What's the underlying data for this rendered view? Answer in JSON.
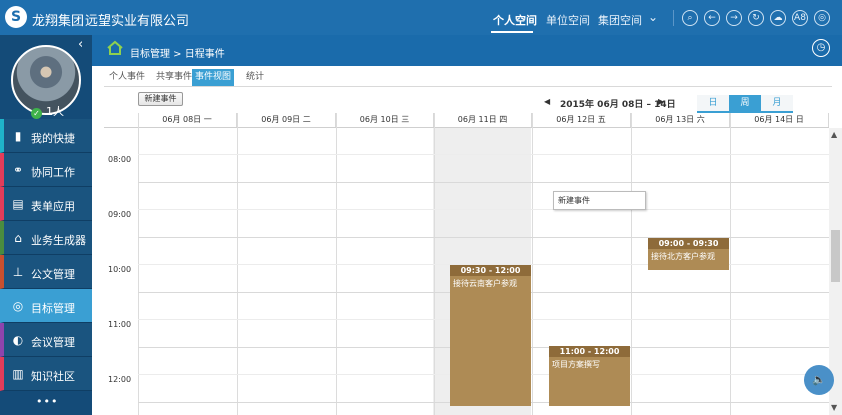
{
  "topbar": {
    "brand": "龙翔集团",
    "company": "远望实业有限公司",
    "nav": [
      {
        "label": "个人空间"
      },
      {
        "label": "单位空间"
      },
      {
        "label": "集团空间"
      }
    ],
    "more_icon": "chevron-down-icon",
    "tools": [
      "search-icon",
      "back-icon",
      "forward-icon",
      "refresh-icon",
      "cloud-icon",
      "font-size-icon",
      "settings-icon"
    ],
    "font_size_label": "A8"
  },
  "sidebar": {
    "user_count": "1人",
    "menu": [
      {
        "label": "我的快捷",
        "icon": "bookmark-icon",
        "accent": "#1fb3c9"
      },
      {
        "label": "协同工作",
        "icon": "collaboration-icon",
        "accent": "#e23c5a"
      },
      {
        "label": "表单应用",
        "icon": "form-icon",
        "accent": "#e23c5a"
      },
      {
        "label": "业务生成器",
        "icon": "house-icon",
        "accent": "#4a8c3f"
      },
      {
        "label": "公文管理",
        "icon": "stamp-icon",
        "accent": "#c8502f"
      },
      {
        "label": "目标管理",
        "icon": "target-icon",
        "accent": "#3a9fd3",
        "active": true
      },
      {
        "label": "会议管理",
        "icon": "meeting-icon",
        "accent": "#8e44ad"
      },
      {
        "label": "知识社区",
        "icon": "book-icon",
        "accent": "#e23c5a"
      }
    ],
    "more": "•••"
  },
  "breadcrumb": "目标管理 > 日程事件",
  "subtabs": [
    {
      "label": "个人事件"
    },
    {
      "label": "共享事件"
    },
    {
      "label": "事件视图",
      "active": true
    },
    {
      "label": "统计"
    }
  ],
  "toolbar": {
    "new_event": "新建事件",
    "date_range": "2015年 06月 08日 – 14日",
    "views": [
      {
        "label": "日"
      },
      {
        "label": "周",
        "active": true
      },
      {
        "label": "月"
      }
    ]
  },
  "days": [
    "06月 08日 一",
    "06月 09日 二",
    "06月 10日 三",
    "06月 11日 四",
    "06月 12日 五",
    "06月 13日 六",
    "06月 14日 日"
  ],
  "today_index": 3,
  "hours": [
    "08:00",
    "09:00",
    "10:00",
    "11:00",
    "12:00"
  ],
  "events": [
    {
      "time": "09:30 - 12:00",
      "title": "接待云南客户参观"
    },
    {
      "time": "11:00 - 12:00",
      "title": "项目方案撰写"
    },
    {
      "time": "09:00 - 09:30",
      "title": "接待北方客户参观"
    }
  ],
  "popup": "新建事件",
  "colors": {
    "topbar": "#1f6fae",
    "sidebar": "#144b78",
    "accent": "#3a9fd3",
    "event": "#ae8b55",
    "event_header": "#8e6b3a"
  }
}
